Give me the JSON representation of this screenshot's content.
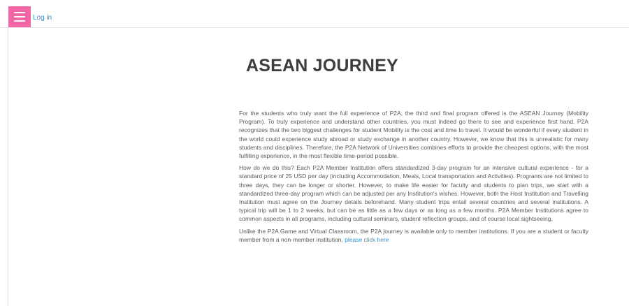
{
  "header": {
    "menu_icon": "hamburger-icon",
    "login_label": "Log in",
    "menu_color": "#f266a6",
    "link_color": "#3a8fc1"
  },
  "main": {
    "title": "ASEAN JOURNEY",
    "paragraphs": [
      "For the students who truly want the full experience of P2A, the third and final program offered is the ASEAN Journey (Mobility Program). To truly experience and understand other countries, you must indeed go there to see and experience first hand. P2A recognizes that the two biggest challenges for student Mobility is the cost and time to travel. It would be wonderful if every student in the world could experience study abroad or study exchange in another country. However, we know that this is unrealistic for many students and disciplines. Therefore, the P2A Network of Universities combines efforts to provide the cheapest options, with the most fulfilling experience, in the most flexible time-period possible.",
      "How do we do this? Each P2A Member Institution offers standardized 3-day program for an intensive cultural experience - for a standard price of 25 USD per day (including Accommodation, Meals, Local transportation and Activities). Programs are not limited to three days, they can be longer or shorter. However, to make life easier for faculty and students to plan trips, we start with a standardized three-day program which can be adjusted per any Institution's wishes. However, both the Host Institution and Travelling Institution must agree on the Journey details beforehand. Many student trips entail several countries and several institutions. A typical trip will be 1 to 2 weeks, but can be as little as a few days or as long as a few months. P2A Member Institutions agree to common aspects in all programs, including cultural seminars, student reflection groups, and of course local sightseeing.",
      "Unlike the P2A Game and Virtual Classroom, the P2A journey is available only to member institutions. If you are a student or faculty member from a non-member institution,"
    ],
    "click_here_label": "please click here"
  }
}
